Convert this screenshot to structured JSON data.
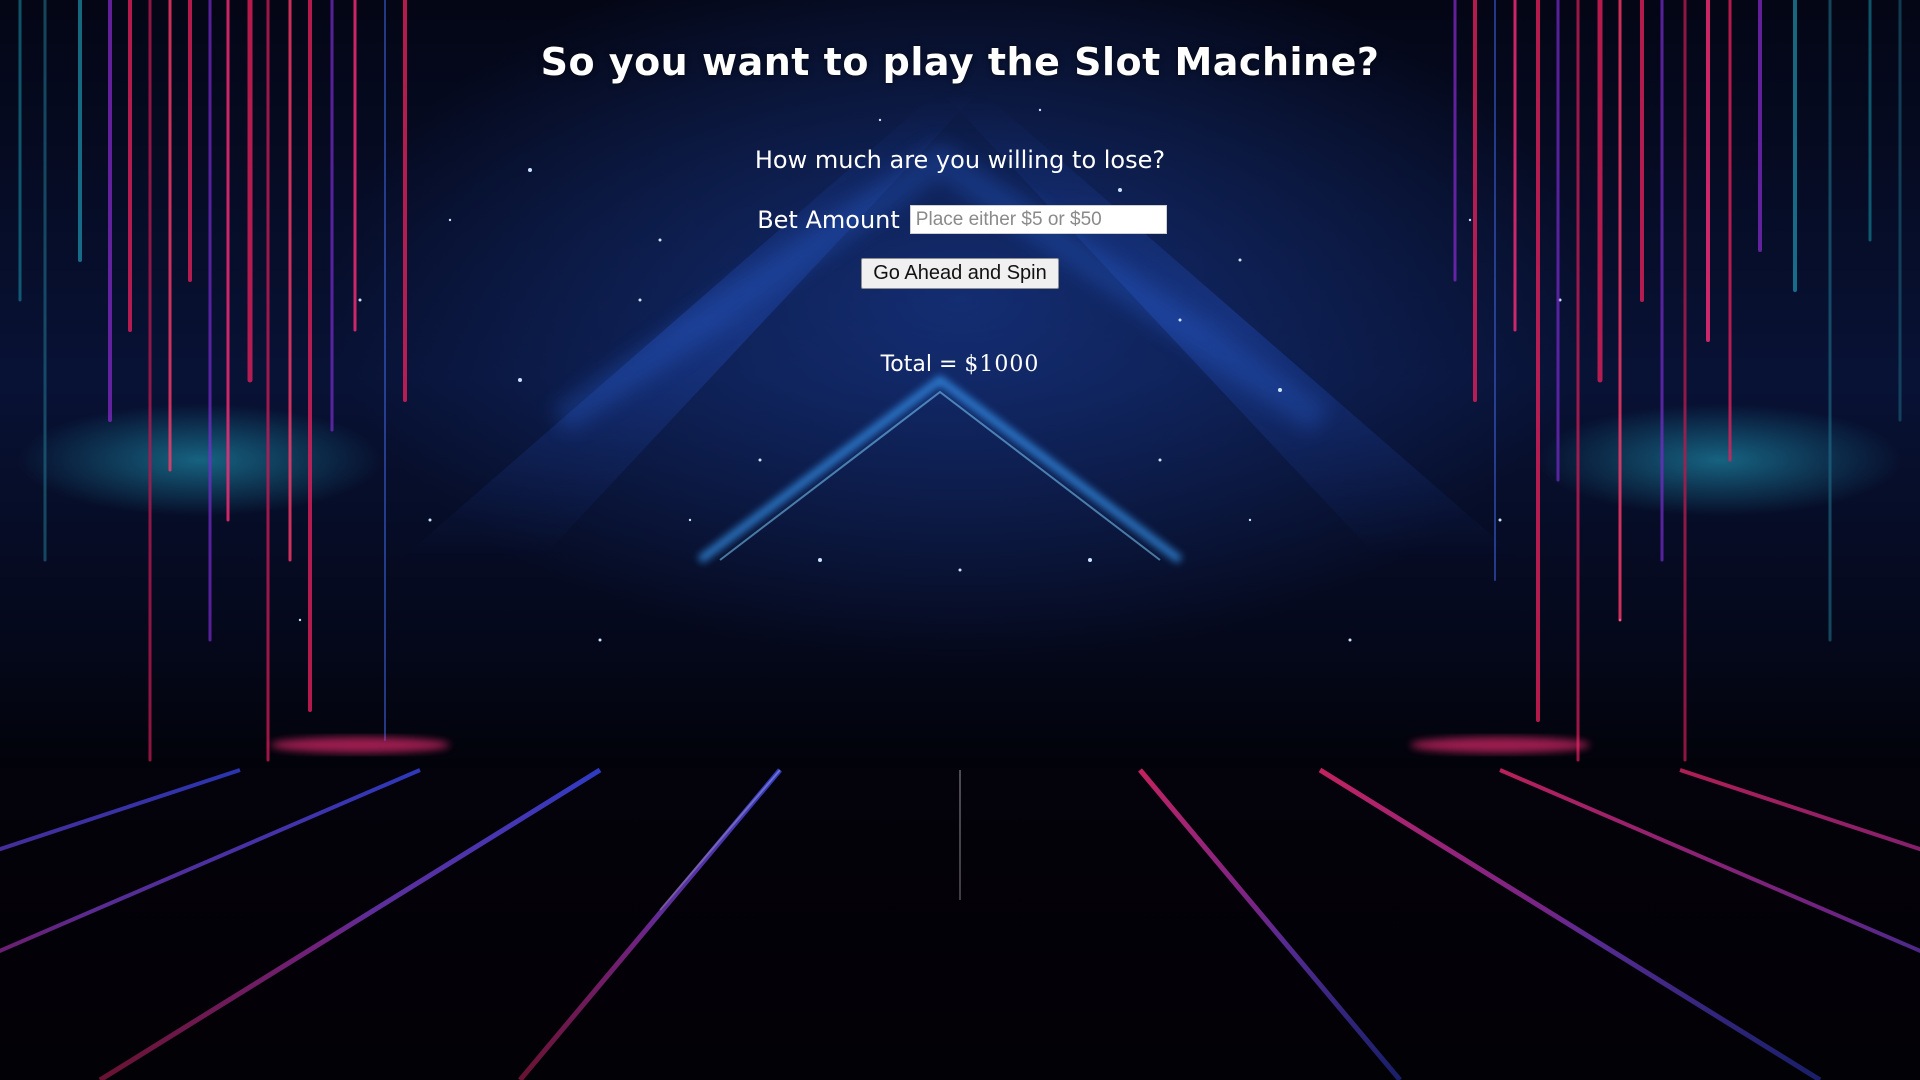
{
  "page": {
    "title": "So you want to play the Slot Machine?",
    "subtitle": "How much are you willing to lose?",
    "bet": {
      "label": "Bet Amount",
      "value": "",
      "placeholder": "Place either $5 or $50"
    },
    "spin_button_label": "Go Ahead and Spin",
    "total": {
      "label": "Total = ",
      "value": "$1000"
    }
  },
  "background": {
    "icon": "neon-grid-stage-background",
    "colors": {
      "sky_top": "#040615",
      "sky_mid": "#081235",
      "beam_blue": "#1e4aa8",
      "glow_cyan": "#28c8e6",
      "rain_pink": "#e0205a",
      "rain_purple": "#7a2bd0",
      "grid_pink": "#ff2d7a",
      "grid_violet": "#b04bff",
      "grid_blue": "#3d4dff"
    }
  }
}
